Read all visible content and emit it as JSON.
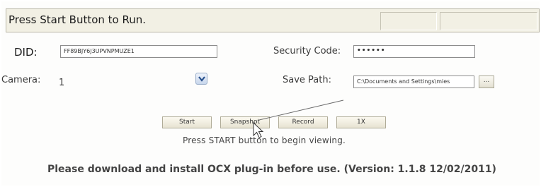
{
  "status": {
    "message": "Press Start Button to Run."
  },
  "form": {
    "did_label": "DID:",
    "did_value": "FF89BJY6J3UPVNPMUZE1",
    "security_label": "Security Code:",
    "security_value": "••••••",
    "camera_label": "Camera:",
    "camera_value": "1",
    "save_path_label": "Save Path:",
    "save_path_value": "C:\\Documents and Settings\\mies",
    "browse_label": "..."
  },
  "controls": {
    "start": "Start",
    "snapshot": "Snapshot",
    "record": "Record",
    "speed": "1X"
  },
  "hint": "Press START button to begin viewing.",
  "footer": "Please download and install OCX plug-in before use. (Version: 1.1.8 12/02/2011)",
  "icons": {
    "dropdown": "chevron-down-icon",
    "cursor": "mouse-pointer-icon"
  }
}
